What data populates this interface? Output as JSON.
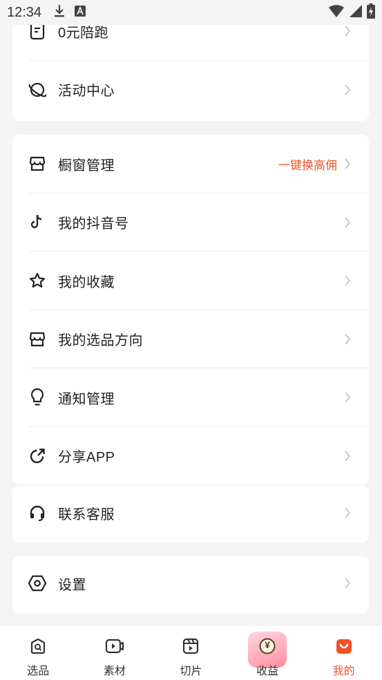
{
  "status": {
    "time": "12:34"
  },
  "card1": {
    "items": [
      {
        "label": "0元陪跑"
      },
      {
        "label": "活动中心"
      }
    ]
  },
  "card2": {
    "items": [
      {
        "label": "橱窗管理",
        "extra": "一键换高佣"
      },
      {
        "label": "我的抖音号"
      },
      {
        "label": "我的收藏"
      },
      {
        "label": "我的选品方向"
      },
      {
        "label": "通知管理"
      },
      {
        "label": "分享APP"
      }
    ]
  },
  "card3": {
    "items": [
      {
        "label": "联系客服"
      }
    ]
  },
  "card4": {
    "items": [
      {
        "label": "设置"
      }
    ]
  },
  "tabbar": {
    "tabs": [
      {
        "label": "选品"
      },
      {
        "label": "素材"
      },
      {
        "label": "切片"
      },
      {
        "label": "收益",
        "badge": "¥"
      },
      {
        "label": "我的"
      }
    ],
    "active_index": 4
  },
  "colors": {
    "accent": "#f0532b",
    "background": "#f4f4f5"
  }
}
